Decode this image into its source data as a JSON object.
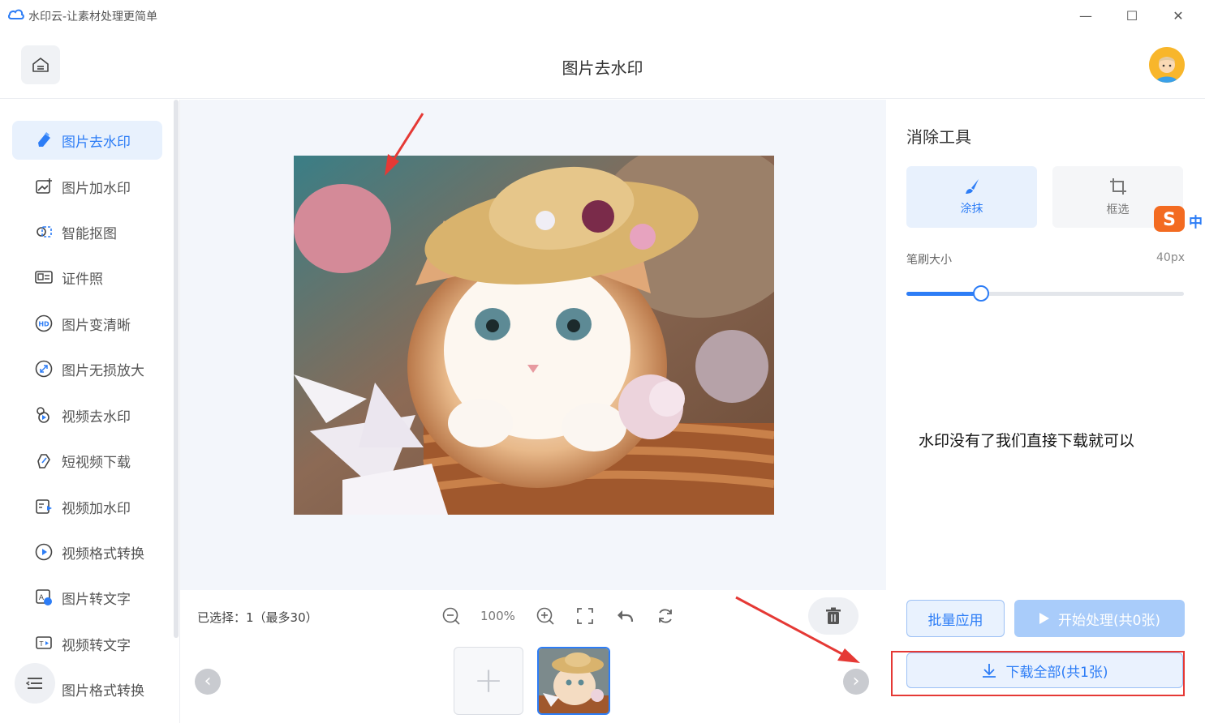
{
  "window": {
    "title": "水印云-让素材处理更简单",
    "minimize_glyph": "—",
    "maximize_glyph": "☐",
    "close_glyph": "✕"
  },
  "header": {
    "title": "图片去水印",
    "home_icon": "home-icon",
    "avatar_icon": "user-avatar"
  },
  "sidebar": {
    "items": [
      {
        "label": "图片去水印",
        "icon": "eraser-icon",
        "active": true
      },
      {
        "label": "图片加水印",
        "icon": "image-add-icon"
      },
      {
        "label": "智能抠图",
        "icon": "cutout-icon"
      },
      {
        "label": "证件照",
        "icon": "id-card-icon"
      },
      {
        "label": "图片变清晰",
        "icon": "hd-icon"
      },
      {
        "label": "图片无损放大",
        "icon": "enlarge-icon"
      },
      {
        "label": "视频去水印",
        "icon": "video-eraser-icon"
      },
      {
        "label": "短视频下载",
        "icon": "link-icon"
      },
      {
        "label": "视频加水印",
        "icon": "video-add-icon"
      },
      {
        "label": "视频格式转换",
        "icon": "play-circle-icon"
      },
      {
        "label": "图片转文字",
        "icon": "image-text-icon"
      },
      {
        "label": "视频转文字",
        "icon": "video-text-icon"
      },
      {
        "label": "图片格式转换",
        "icon": "format-icon"
      }
    ],
    "menu_icon": "menu-icon"
  },
  "canvas": {
    "image_desc_icon": "kitten-image"
  },
  "toolbar": {
    "selected_text": "已选择：1（最多30）",
    "zoom_level": "100%",
    "tools": [
      "zoom-out-icon",
      "zoom-in-icon",
      "fit-screen-icon",
      "undo-icon",
      "reset-icon"
    ],
    "trash_icon": "trash-icon"
  },
  "filmstrip": {
    "add_glyph": "+",
    "prev_glyph": "‹",
    "next_glyph": "›"
  },
  "right_panel": {
    "title": "消除工具",
    "tools": [
      {
        "label": "涂抹",
        "icon": "brush-icon",
        "active": true
      },
      {
        "label": "框选",
        "icon": "crop-icon",
        "active": false
      }
    ],
    "brush_size_label": "笔刷大小",
    "brush_size_value": "40px",
    "brush_slider_fraction": 0.27,
    "note": "水印没有了我们直接下载就可以",
    "batch_apply": "批量应用",
    "start_process": "开始处理(共0张)",
    "download_all": "下载全部(共1张)",
    "ime_char": "中"
  },
  "colors": {
    "accent": "#2d7df6",
    "annotation_red": "#e53935"
  }
}
